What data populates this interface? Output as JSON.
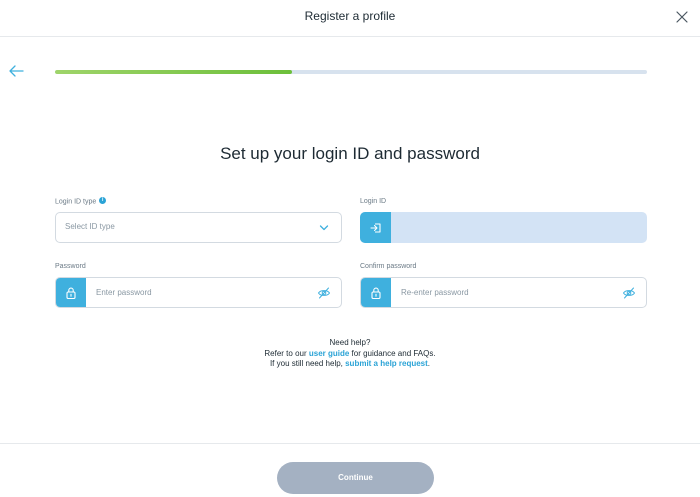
{
  "header": {
    "title": "Register a profile",
    "close_icon": "close-icon"
  },
  "nav": {
    "back_icon": "arrow-left-icon"
  },
  "progress": {
    "fraction": 0.4,
    "filled_color": "#6cbf3a",
    "track_color": "#d7e2ee"
  },
  "page": {
    "title": "Set up your login ID and password"
  },
  "login_id_type": {
    "label": "Login ID type",
    "placeholder": "Select ID type",
    "info_icon": "info-icon",
    "dropdown_icon": "chevron-down-icon"
  },
  "login_id": {
    "label": "Login ID",
    "prefix_icon": "login-icon",
    "value": ""
  },
  "password": {
    "label": "Password",
    "placeholder": "Enter password",
    "prefix_icon": "lock-icon",
    "toggle_icon": "eye-off-icon"
  },
  "confirm_password": {
    "label": "Confirm password",
    "placeholder": "Re-enter password",
    "prefix_icon": "lock-icon",
    "toggle_icon": "eye-off-icon"
  },
  "help": {
    "heading": "Need help?",
    "line2_prefix": "Refer to our ",
    "line2_link": "user guide",
    "line2_suffix": " for guidance and FAQs.",
    "line3_prefix": "If you still need help, ",
    "line3_link": "submit a help request",
    "line3_suffix": "."
  },
  "footer": {
    "continue_label": "Continue"
  },
  "colors": {
    "accent": "#3fb0de",
    "link": "#2aa3d6",
    "button_disabled": "#a4b1c2"
  }
}
